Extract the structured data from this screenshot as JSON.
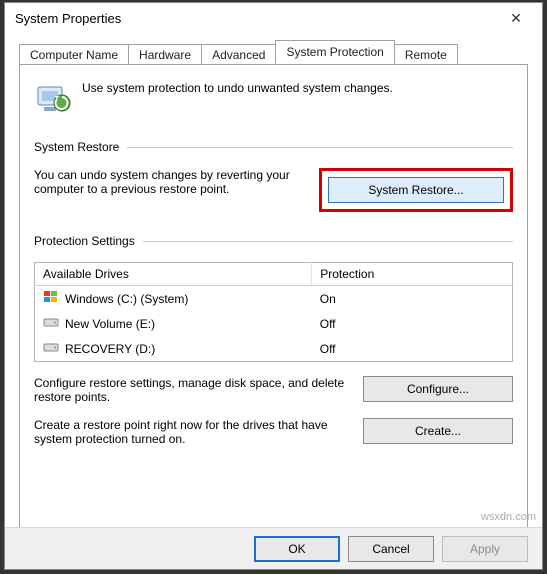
{
  "window": {
    "title": "System Properties"
  },
  "tabs": [
    {
      "label": "Computer Name"
    },
    {
      "label": "Hardware"
    },
    {
      "label": "Advanced"
    },
    {
      "label": "System Protection",
      "active": true
    },
    {
      "label": "Remote"
    }
  ],
  "intro": "Use system protection to undo unwanted system changes.",
  "groups": {
    "restore": {
      "title": "System Restore",
      "text": "You can undo system changes by reverting your computer to a previous restore point.",
      "button": "System Restore..."
    },
    "protection": {
      "title": "Protection Settings",
      "columns": {
        "drive": "Available Drives",
        "status": "Protection"
      },
      "drives": [
        {
          "name": "Windows (C:) (System)",
          "status": "On",
          "icon": "windows"
        },
        {
          "name": "New Volume (E:)",
          "status": "Off",
          "icon": "hdd"
        },
        {
          "name": "RECOVERY (D:)",
          "status": "Off",
          "icon": "hdd"
        }
      ],
      "configure": {
        "text": "Configure restore settings, manage disk space, and delete restore points.",
        "button": "Configure..."
      },
      "create": {
        "text": "Create a restore point right now for the drives that have system protection turned on.",
        "button": "Create..."
      }
    }
  },
  "footer": {
    "ok": "OK",
    "cancel": "Cancel",
    "apply": "Apply"
  },
  "watermark": "wsxdn.com"
}
